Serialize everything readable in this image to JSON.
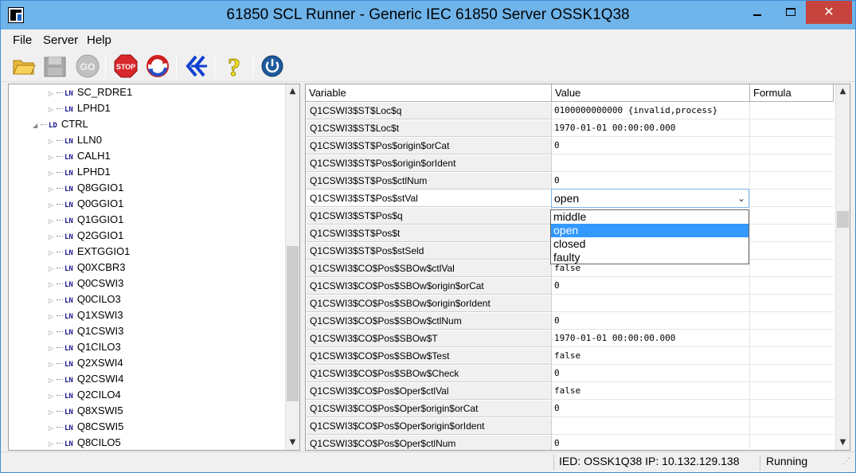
{
  "window": {
    "title": "61850 SCL Runner - Generic IEC 61850 Server OSSK1Q38",
    "close_glyph": "✕"
  },
  "menu": [
    "File",
    "Server",
    "Help"
  ],
  "toolbar": {
    "buttons": [
      {
        "name": "open-folder-icon"
      },
      {
        "name": "save-icon"
      },
      {
        "name": "go-button",
        "label": "GO"
      },
      {
        "name": "stop-button",
        "label": "STOP"
      },
      {
        "name": "refresh-icon"
      },
      {
        "name": "tree-expand-icon"
      },
      {
        "name": "help-icon",
        "label": "?"
      },
      {
        "name": "power-icon"
      }
    ]
  },
  "tree": {
    "tag_ln": "LN",
    "tag_ld": "LD",
    "items": [
      {
        "type": "LN",
        "label": "SC_RDRE1"
      },
      {
        "type": "LN",
        "label": "LPHD1"
      },
      {
        "type": "LD",
        "label": "CTRL"
      },
      {
        "type": "LN",
        "label": "LLN0"
      },
      {
        "type": "LN",
        "label": "CALH1"
      },
      {
        "type": "LN",
        "label": "LPHD1"
      },
      {
        "type": "LN",
        "label": "Q8GGIO1"
      },
      {
        "type": "LN",
        "label": "Q0GGIO1"
      },
      {
        "type": "LN",
        "label": "Q1GGIO1"
      },
      {
        "type": "LN",
        "label": "Q2GGIO1"
      },
      {
        "type": "LN",
        "label": "EXTGGIO1"
      },
      {
        "type": "LN",
        "label": "Q0XCBR3"
      },
      {
        "type": "LN",
        "label": "Q0CSWI3"
      },
      {
        "type": "LN",
        "label": "Q0CILO3"
      },
      {
        "type": "LN",
        "label": "Q1XSWI3"
      },
      {
        "type": "LN",
        "label": "Q1CSWI3"
      },
      {
        "type": "LN",
        "label": "Q1CILO3"
      },
      {
        "type": "LN",
        "label": "Q2XSWI4"
      },
      {
        "type": "LN",
        "label": "Q2CSWI4"
      },
      {
        "type": "LN",
        "label": "Q2CILO4"
      },
      {
        "type": "LN",
        "label": "Q8XSWI5"
      },
      {
        "type": "LN",
        "label": "Q8CSWI5"
      },
      {
        "type": "LN",
        "label": "Q8CILO5"
      }
    ]
  },
  "grid": {
    "headers": [
      "Variable",
      "Value",
      "Formula"
    ],
    "rows": [
      {
        "variable": "Q1CSWI3$ST$Loc$q",
        "value": "0100000000000 {invalid,process}"
      },
      {
        "variable": "Q1CSWI3$ST$Loc$t",
        "value": "1970-01-01 00:00:00.000"
      },
      {
        "variable": "Q1CSWI3$ST$Pos$origin$orCat",
        "value": "0"
      },
      {
        "variable": "Q1CSWI3$ST$Pos$origin$orIdent",
        "value": ""
      },
      {
        "variable": "Q1CSWI3$ST$Pos$ctlNum",
        "value": "0"
      },
      {
        "variable": "Q1CSWI3$ST$Pos$stVal",
        "value": ""
      },
      {
        "variable": "Q1CSWI3$ST$Pos$q",
        "value": ""
      },
      {
        "variable": "Q1CSWI3$ST$Pos$t",
        "value": ""
      },
      {
        "variable": "Q1CSWI3$ST$Pos$stSeld",
        "value": ""
      },
      {
        "variable": "Q1CSWI3$CO$Pos$SBOw$ctlVal",
        "value": "false"
      },
      {
        "variable": "Q1CSWI3$CO$Pos$SBOw$origin$orCat",
        "value": "0"
      },
      {
        "variable": "Q1CSWI3$CO$Pos$SBOw$origin$orIdent",
        "value": ""
      },
      {
        "variable": "Q1CSWI3$CO$Pos$SBOw$ctlNum",
        "value": "0"
      },
      {
        "variable": "Q1CSWI3$CO$Pos$SBOw$T",
        "value": "1970-01-01 00:00:00.000"
      },
      {
        "variable": "Q1CSWI3$CO$Pos$SBOw$Test",
        "value": "false"
      },
      {
        "variable": "Q1CSWI3$CO$Pos$SBOw$Check",
        "value": "0"
      },
      {
        "variable": "Q1CSWI3$CO$Pos$Oper$ctlVal",
        "value": "false"
      },
      {
        "variable": "Q1CSWI3$CO$Pos$Oper$origin$orCat",
        "value": "0"
      },
      {
        "variable": "Q1CSWI3$CO$Pos$Oper$origin$orIdent",
        "value": ""
      },
      {
        "variable": "Q1CSWI3$CO$Pos$Oper$ctlNum",
        "value": "0"
      }
    ],
    "editing_row": 5,
    "combo_value": "open",
    "dropdown_options": [
      "middle",
      "open",
      "closed",
      "faulty"
    ],
    "dropdown_highlight": 1
  },
  "status": {
    "ied": "IED: OSSK1Q38 IP: 10.132.129.138",
    "state": "Running"
  },
  "colors": {
    "titlebar": "#6fb4ea",
    "close_button": "#c7433d",
    "selection": "#3399ff"
  }
}
